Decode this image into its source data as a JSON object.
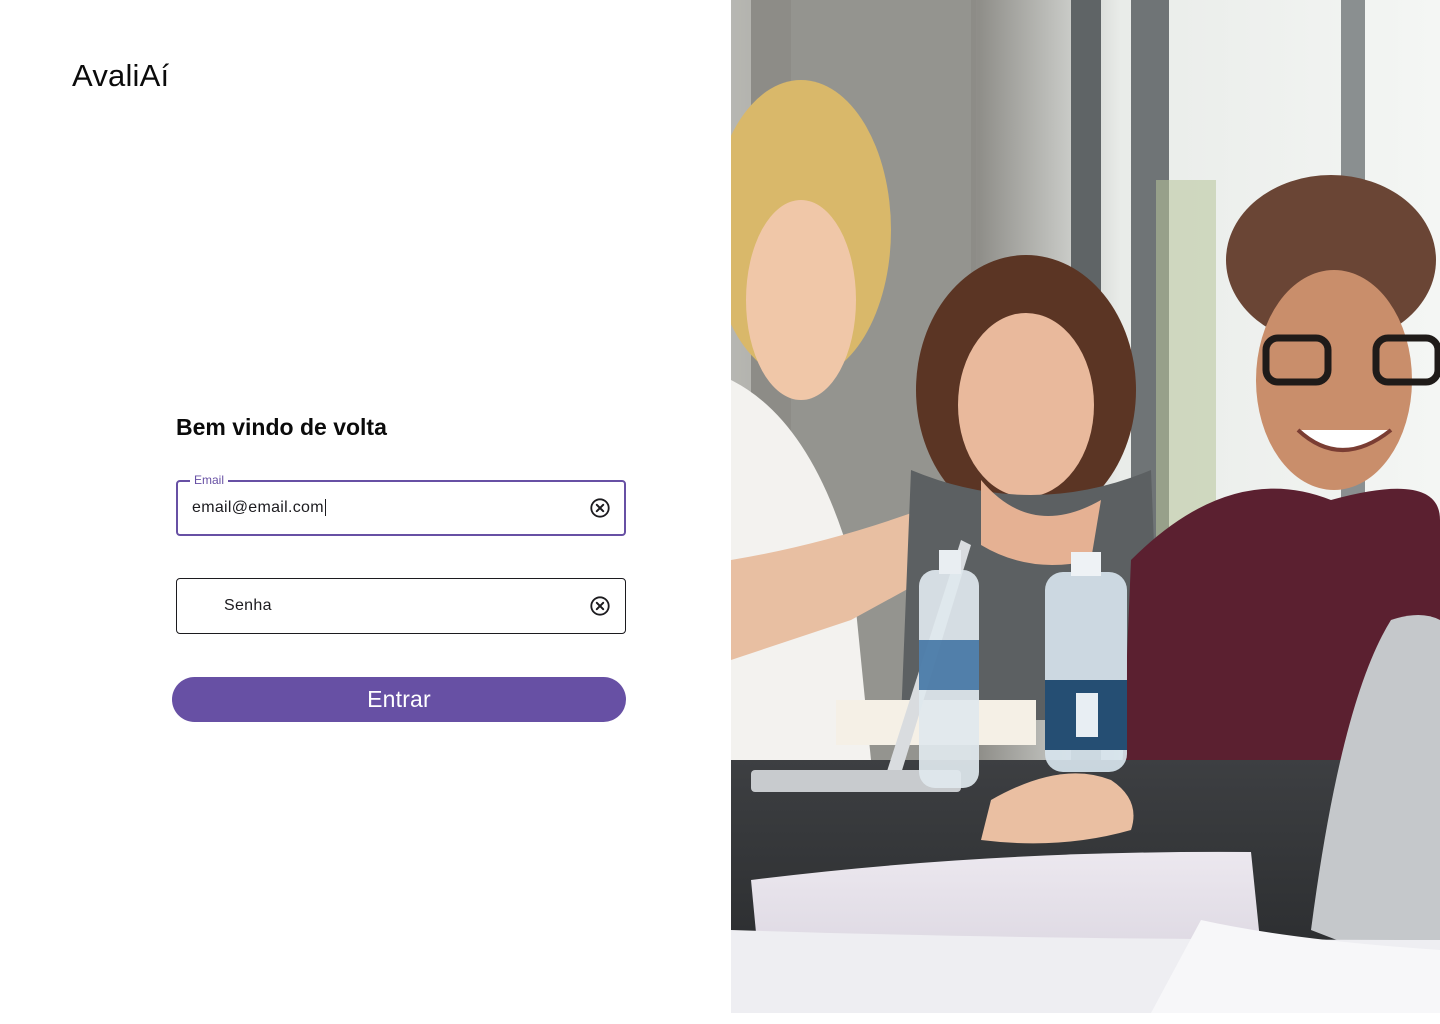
{
  "app": {
    "logo": "AvaliAí"
  },
  "login": {
    "heading": "Bem vindo de volta",
    "email": {
      "label": "Email",
      "value": "email@email.com"
    },
    "password": {
      "placeholder": "Senha",
      "value": ""
    },
    "submit_label": "Entrar"
  },
  "icons": {
    "clear": "clear-circle-icon"
  },
  "colors": {
    "primary": "#6750a4",
    "outline": "#1c1b1f",
    "text": "#0b0b0b",
    "background": "#ffffff"
  }
}
